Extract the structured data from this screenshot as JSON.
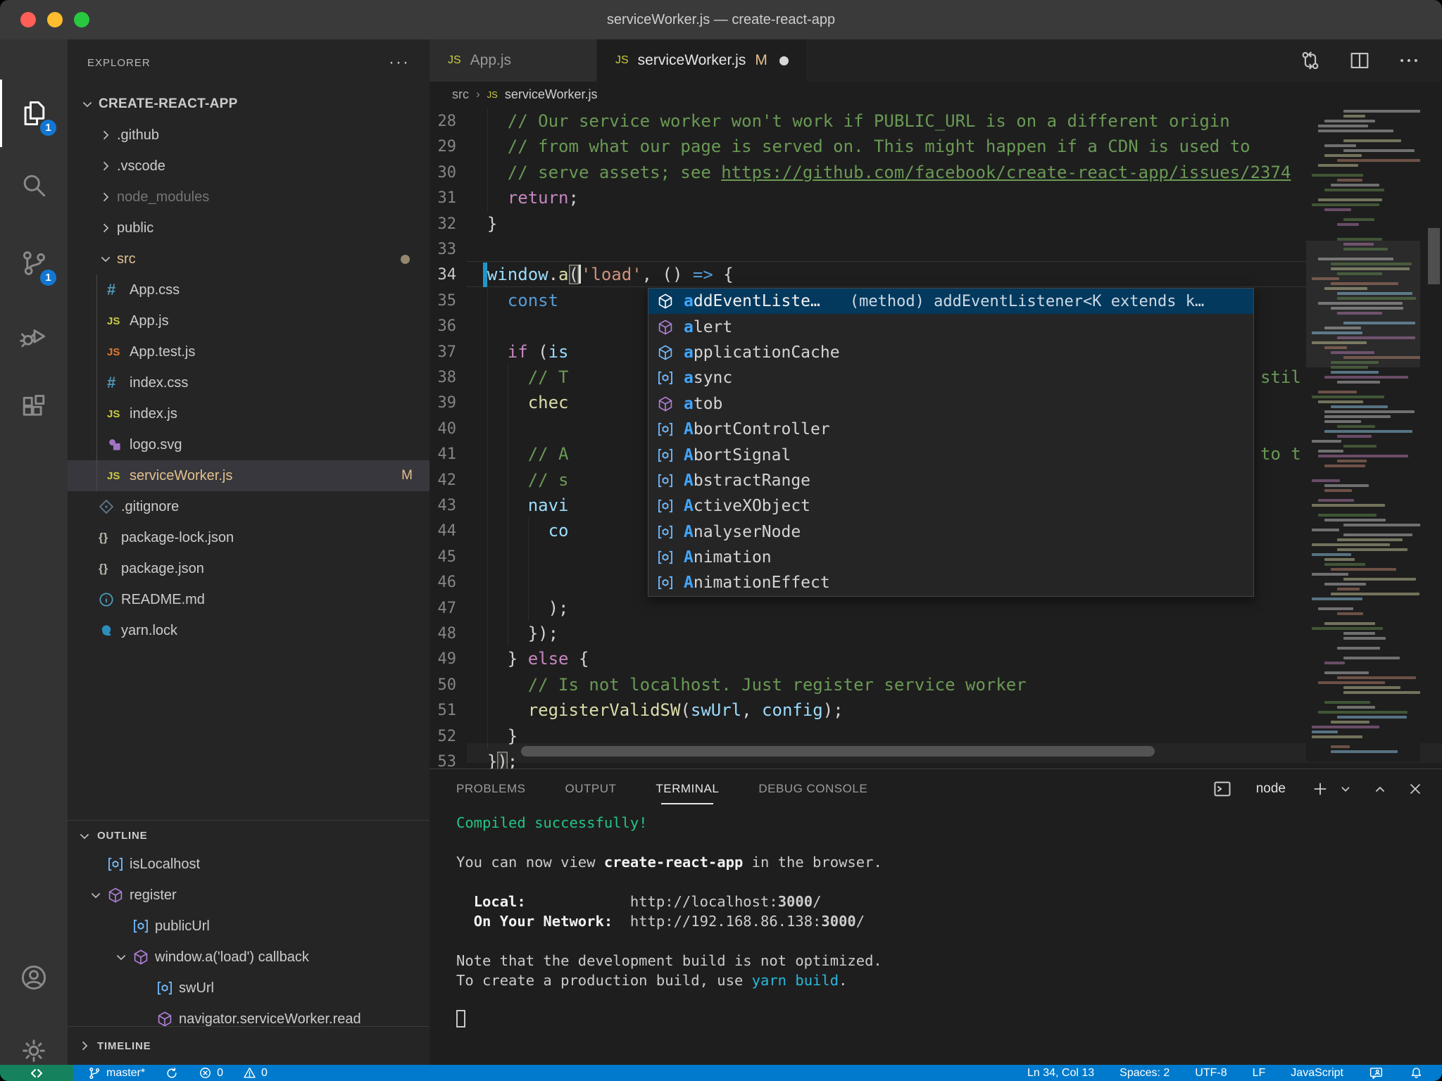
{
  "window": {
    "title": "serviceWorker.js — create-react-app"
  },
  "colors": {
    "statusbar": "#007acc",
    "remote_indicator": "#16825d",
    "activity_badge": "#1277d2",
    "suggest_selection": "#04395e",
    "git_modified": "#e2c08d",
    "list_selection": "#37373d",
    "terminal_green": "#23c586",
    "terminal_cyan": "#29b8db",
    "modified_gutter": "#2196c9"
  },
  "activity_bar": {
    "items": [
      {
        "name": "explorer",
        "icon": "files-icon",
        "active": true,
        "badge": "1"
      },
      {
        "name": "search",
        "icon": "search-icon"
      },
      {
        "name": "source-control",
        "icon": "source-control-icon",
        "badge": "1"
      },
      {
        "name": "run-debug",
        "icon": "debug-icon"
      },
      {
        "name": "extensions",
        "icon": "extensions-icon"
      }
    ],
    "bottom_items": [
      {
        "name": "accounts",
        "icon": "account-icon"
      },
      {
        "name": "settings",
        "icon": "gear-icon"
      }
    ]
  },
  "explorer": {
    "title": "EXPLORER",
    "more_label": "···",
    "root": "CREATE-REACT-APP",
    "files": [
      {
        "label": ".github",
        "type": "folder",
        "depth": 1
      },
      {
        "label": ".vscode",
        "type": "folder",
        "depth": 1
      },
      {
        "label": "node_modules",
        "type": "folder",
        "depth": 1,
        "dim": true
      },
      {
        "label": "public",
        "type": "folder",
        "depth": 1
      },
      {
        "label": "src",
        "type": "folder",
        "depth": 1,
        "expanded": true,
        "modified": true,
        "dot": true
      },
      {
        "label": "App.css",
        "icon": "css",
        "depth": 2
      },
      {
        "label": "App.js",
        "icon": "js",
        "depth": 2
      },
      {
        "label": "App.test.js",
        "icon": "js-test",
        "depth": 2
      },
      {
        "label": "index.css",
        "icon": "css",
        "depth": 2
      },
      {
        "label": "index.js",
        "icon": "js",
        "depth": 2
      },
      {
        "label": "logo.svg",
        "icon": "svg",
        "depth": 2
      },
      {
        "label": "serviceWorker.js",
        "icon": "js",
        "depth": 2,
        "selected": true,
        "modified": true,
        "badge": "M"
      },
      {
        "label": ".gitignore",
        "icon": "git",
        "depth": 1
      },
      {
        "label": "package-lock.json",
        "icon": "json",
        "depth": 1
      },
      {
        "label": "package.json",
        "icon": "json",
        "depth": 1
      },
      {
        "label": "README.md",
        "icon": "info",
        "depth": 1
      },
      {
        "label": "yarn.lock",
        "icon": "yarn",
        "depth": 1
      }
    ],
    "outline": {
      "title": "OUTLINE",
      "items": [
        {
          "label": "isLocalhost",
          "icon": "variable",
          "depth": 1
        },
        {
          "label": "register",
          "icon": "method",
          "depth": 1,
          "expanded": true
        },
        {
          "label": "publicUrl",
          "icon": "variable",
          "depth": 2
        },
        {
          "label": "window.a('load') callback",
          "icon": "method",
          "depth": 2,
          "expanded": true
        },
        {
          "label": "swUrl",
          "icon": "variable",
          "depth": 3
        },
        {
          "label": "navigator.serviceWorker.read",
          "icon": "method",
          "depth": 3
        }
      ]
    },
    "timeline": {
      "title": "TIMELINE"
    }
  },
  "editor": {
    "tabs": [
      {
        "label": "App.js",
        "icon": "js"
      },
      {
        "label": "serviceWorker.js",
        "icon": "js",
        "active": true,
        "git_badge": "M",
        "dirty": true
      }
    ],
    "breadcrumb": {
      "folder": "src",
      "file": "serviceWorker.js"
    },
    "code_lines": [
      {
        "n": 28,
        "ind": 4,
        "segs": [
          [
            "// Our service worker won't work if PUBLIC_URL is on a different origin",
            "cm"
          ]
        ]
      },
      {
        "n": 29,
        "ind": 4,
        "segs": [
          [
            "// from what our page is served on. This might happen if a CDN is used to",
            "cm"
          ]
        ]
      },
      {
        "n": 30,
        "ind": 4,
        "segs": [
          [
            "// serve assets; see ",
            "cm"
          ],
          [
            "https://github.com/facebook/create-react-app/issues/2374",
            "link"
          ]
        ]
      },
      {
        "n": 31,
        "ind": 4,
        "segs": [
          [
            "return",
            "kw"
          ],
          [
            ";",
            "fg"
          ]
        ]
      },
      {
        "n": 32,
        "ind": 2,
        "segs": [
          [
            "}",
            "fg"
          ]
        ]
      },
      {
        "n": 33,
        "ind": 0,
        "segs": []
      },
      {
        "n": 34,
        "ind": 2,
        "current": true,
        "mod": true,
        "segs": [
          [
            "window",
            "var"
          ],
          [
            ".",
            "fg"
          ],
          [
            "a",
            "fn"
          ],
          [
            "(",
            "brkt"
          ],
          [
            "",
            "cursor"
          ],
          [
            "'load'",
            "str"
          ],
          [
            ", () ",
            "fg"
          ],
          [
            "=>",
            "kwb"
          ],
          [
            " {",
            "fg"
          ]
        ]
      },
      {
        "n": 35,
        "ind": 4,
        "segs": [
          [
            "const",
            "kwb"
          ],
          [
            " ",
            "fg"
          ]
        ]
      },
      {
        "n": 36,
        "ind": 0,
        "segs": []
      },
      {
        "n": 37,
        "ind": 4,
        "segs": [
          [
            "if",
            "kw"
          ],
          [
            " (",
            "fg"
          ],
          [
            "is",
            "var"
          ]
        ]
      },
      {
        "n": 38,
        "ind": 6,
        "segs": [
          [
            "// T",
            "cm"
          ]
        ]
      },
      {
        "n": 39,
        "ind": 6,
        "segs": [
          [
            "chec",
            "fn"
          ]
        ]
      },
      {
        "n": 40,
        "ind": 0,
        "segs": []
      },
      {
        "n": 41,
        "ind": 6,
        "segs": [
          [
            "// A",
            "cm"
          ]
        ]
      },
      {
        "n": 42,
        "ind": 6,
        "segs": [
          [
            "// s",
            "cm"
          ]
        ]
      },
      {
        "n": 43,
        "ind": 6,
        "segs": [
          [
            "navi",
            "var"
          ]
        ]
      },
      {
        "n": 44,
        "ind": 8,
        "segs": [
          [
            "co",
            "var"
          ]
        ]
      },
      {
        "n": 45,
        "ind": 0,
        "segs": []
      },
      {
        "n": 46,
        "ind": 0,
        "segs": []
      },
      {
        "n": 47,
        "ind": 8,
        "segs": [
          [
            ");",
            "fg"
          ]
        ]
      },
      {
        "n": 48,
        "ind": 6,
        "segs": [
          [
            "});",
            "fg"
          ]
        ]
      },
      {
        "n": 49,
        "ind": 4,
        "segs": [
          [
            "} ",
            "fg"
          ],
          [
            "else",
            "kw"
          ],
          [
            " {",
            "fg"
          ]
        ]
      },
      {
        "n": 50,
        "ind": 6,
        "segs": [
          [
            "// Is not localhost. Just register service worker",
            "cm"
          ]
        ]
      },
      {
        "n": 51,
        "ind": 6,
        "segs": [
          [
            "registerValidSW",
            "fn"
          ],
          [
            "(",
            "fg"
          ],
          [
            "swUrl",
            "var"
          ],
          [
            ", ",
            "fg"
          ],
          [
            "config",
            "var"
          ],
          [
            ");",
            "fg"
          ]
        ]
      },
      {
        "n": 52,
        "ind": 4,
        "segs": [
          [
            "}",
            "fg"
          ]
        ]
      },
      {
        "n": 53,
        "ind": 2,
        "segs": [
          [
            "}",
            "fg"
          ],
          [
            ")",
            "brkt"
          ],
          [
            ";",
            "fg"
          ]
        ]
      }
    ],
    "overflow_fragments": [
      {
        "line": 38,
        "text": "stil"
      },
      {
        "line": 41,
        "text": "to t"
      }
    ]
  },
  "suggest": {
    "items": [
      {
        "label": "addEventListe…",
        "match": "a",
        "icon": "method",
        "icon_color": "#ffffff",
        "detail": "(method) addEventListener<K extends k…",
        "selected": true
      },
      {
        "label": "alert",
        "match": "a",
        "icon": "method",
        "icon_color": "#b180d7"
      },
      {
        "label": "applicationCache",
        "match": "a",
        "icon": "method",
        "icon_color": "#75beff"
      },
      {
        "label": "async",
        "match": "a",
        "icon": "variable",
        "icon_color": "#75beff"
      },
      {
        "label": "atob",
        "match": "a",
        "icon": "method",
        "icon_color": "#b180d7"
      },
      {
        "label": "AbortController",
        "match": "A",
        "icon": "variable",
        "icon_color": "#75beff"
      },
      {
        "label": "AbortSignal",
        "match": "A",
        "icon": "variable",
        "icon_color": "#75beff"
      },
      {
        "label": "AbstractRange",
        "match": "A",
        "icon": "variable",
        "icon_color": "#75beff"
      },
      {
        "label": "ActiveXObject",
        "match": "A",
        "icon": "variable",
        "icon_color": "#75beff"
      },
      {
        "label": "AnalyserNode",
        "match": "A",
        "icon": "variable",
        "icon_color": "#75beff"
      },
      {
        "label": "Animation",
        "match": "A",
        "icon": "variable",
        "icon_color": "#75beff"
      },
      {
        "label": "AnimationEffect",
        "match": "A",
        "icon": "variable",
        "icon_color": "#75beff"
      }
    ]
  },
  "panel": {
    "tabs": [
      {
        "label": "PROBLEMS"
      },
      {
        "label": "OUTPUT"
      },
      {
        "label": "TERMINAL",
        "active": true
      },
      {
        "label": "DEBUG CONSOLE"
      }
    ],
    "shell_label": "node",
    "terminal_lines": [
      [
        [
          "Compiled successfully!",
          "green"
        ]
      ],
      [],
      [
        [
          "You can now view ",
          "fg"
        ],
        [
          "create-react-app",
          "bold"
        ],
        [
          " in the browser.",
          "fg"
        ]
      ],
      [],
      [
        [
          "  ",
          "fg"
        ],
        [
          "Local:",
          "bold"
        ],
        [
          "            ",
          "fg"
        ],
        [
          "http://localhost:",
          "fg"
        ],
        [
          "3000",
          "boldfg"
        ],
        [
          "/",
          "fg"
        ]
      ],
      [
        [
          "  ",
          "fg"
        ],
        [
          "On Your Network:",
          "bold"
        ],
        [
          "  ",
          "fg"
        ],
        [
          "http://192.168.86.138:",
          "fg"
        ],
        [
          "3000",
          "boldfg"
        ],
        [
          "/",
          "fg"
        ]
      ],
      [],
      [
        [
          "Note that the development build is not optimized.",
          "fg"
        ]
      ],
      [
        [
          "To create a production build, use ",
          "fg"
        ],
        [
          "yarn build",
          "cyan"
        ],
        [
          ".",
          "fg"
        ]
      ],
      [],
      [
        [
          "",
          "cursor"
        ]
      ]
    ]
  },
  "status_bar": {
    "left": [
      {
        "name": "remote",
        "icon": "remote-icon",
        "label": ""
      },
      {
        "name": "git-branch",
        "icon": "branch-icon",
        "label": "master*"
      },
      {
        "name": "sync",
        "icon": "sync-icon",
        "label": ""
      },
      {
        "name": "errors",
        "icon": "error-icon",
        "label": "0"
      },
      {
        "name": "warnings",
        "icon": "warning-icon",
        "label": "0"
      }
    ],
    "right": [
      {
        "name": "cursor-position",
        "label": "Ln 34, Col 13"
      },
      {
        "name": "indentation",
        "label": "Spaces: 2"
      },
      {
        "name": "encoding",
        "label": "UTF-8"
      },
      {
        "name": "eol",
        "label": "LF"
      },
      {
        "name": "language-mode",
        "label": "JavaScript"
      },
      {
        "name": "feedback",
        "icon": "feedback-icon",
        "label": ""
      },
      {
        "name": "notifications",
        "icon": "bell-icon",
        "label": ""
      }
    ]
  }
}
